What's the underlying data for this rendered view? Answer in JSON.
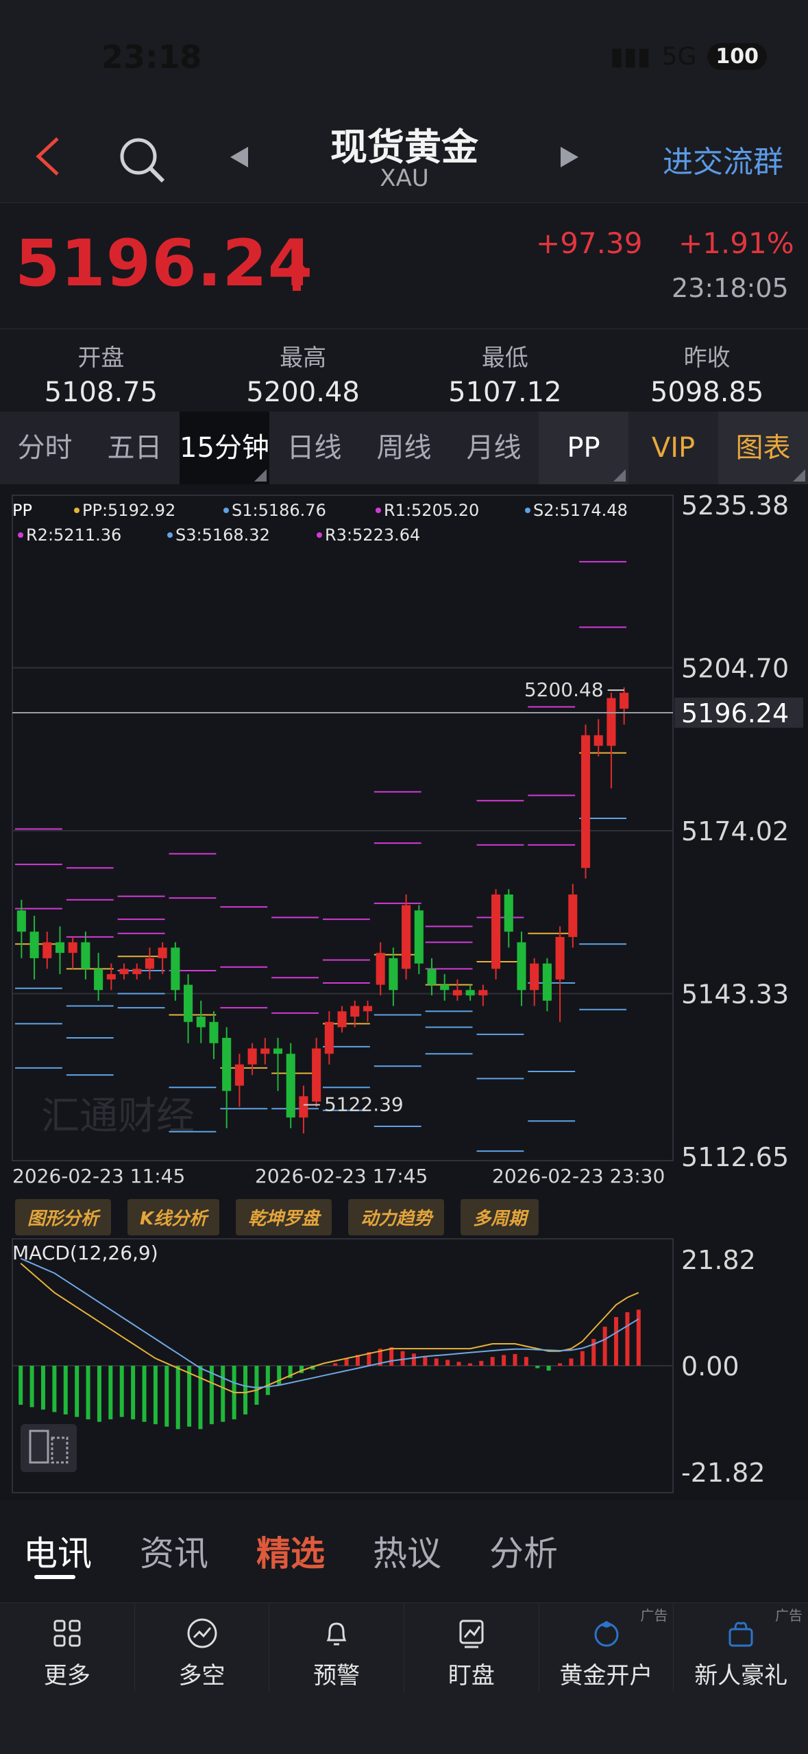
{
  "status": {
    "time": "23:18",
    "network": "5G",
    "battery": "100"
  },
  "header": {
    "title": "现货黄金",
    "subtitle": "XAU",
    "group_link": "进交流群"
  },
  "quote": {
    "price": "5196.24",
    "change": "+97.39",
    "pct": "+1.91%",
    "time": "23:18:05"
  },
  "stats": [
    {
      "label": "开盘",
      "value": "5108.75"
    },
    {
      "label": "最高",
      "value": "5200.48"
    },
    {
      "label": "最低",
      "value": "5107.12"
    },
    {
      "label": "昨收",
      "value": "5098.85"
    }
  ],
  "tabs": [
    "分时",
    "五日",
    "15分钟",
    "日线",
    "周线",
    "月线",
    "PP",
    "VIP",
    "图表"
  ],
  "pivot": {
    "header": "PP",
    "pp": "PP:5192.92",
    "s1": "S1:5186.76",
    "r1": "R1:5205.20",
    "s2": "S2:5174.48",
    "r2": "R2:5211.36",
    "s3": "S3:5168.32",
    "r3": "R3:5223.64"
  },
  "chart_data": {
    "type": "candlestick",
    "y_ticks": [
      "5235.38",
      "5204.70",
      "5174.02",
      "5143.33",
      "5112.65"
    ],
    "y_range": [
      5112.65,
      5235.38
    ],
    "last_price_label": "5196.24",
    "high_label": "5200.48",
    "low_label": "5122.39",
    "x_labels": [
      "2026-02-23 11:45",
      "2026-02-23 17:45",
      "2026-02-23 23:30"
    ],
    "candles": [
      {
        "o": 5159,
        "c": 5155,
        "h": 5161,
        "l": 5150
      },
      {
        "o": 5155,
        "c": 5150,
        "h": 5158,
        "l": 5146
      },
      {
        "o": 5150,
        "c": 5153,
        "h": 5155,
        "l": 5148
      },
      {
        "o": 5153,
        "c": 5151,
        "h": 5156,
        "l": 5147
      },
      {
        "o": 5151,
        "c": 5153,
        "h": 5154,
        "l": 5148
      },
      {
        "o": 5153,
        "c": 5148,
        "h": 5155,
        "l": 5146
      },
      {
        "o": 5148,
        "c": 5144,
        "h": 5151,
        "l": 5142
      },
      {
        "o": 5146,
        "c": 5147,
        "h": 5149,
        "l": 5144
      },
      {
        "o": 5147,
        "c": 5148,
        "h": 5149,
        "l": 5146
      },
      {
        "o": 5147,
        "c": 5148,
        "h": 5149,
        "l": 5146
      },
      {
        "o": 5148,
        "c": 5150,
        "h": 5152,
        "l": 5146
      },
      {
        "o": 5150,
        "c": 5152,
        "h": 5153,
        "l": 5147
      },
      {
        "o": 5152,
        "c": 5144,
        "h": 5153,
        "l": 5142
      },
      {
        "o": 5145,
        "c": 5138,
        "h": 5147,
        "l": 5134
      },
      {
        "o": 5139,
        "c": 5137,
        "h": 5142,
        "l": 5134
      },
      {
        "o": 5138,
        "c": 5134,
        "h": 5140,
        "l": 5131
      },
      {
        "o": 5135,
        "c": 5125,
        "h": 5137,
        "l": 5118
      },
      {
        "o": 5126,
        "c": 5130,
        "h": 5132,
        "l": 5122
      },
      {
        "o": 5130,
        "c": 5133,
        "h": 5134,
        "l": 5128
      },
      {
        "o": 5132,
        "c": 5133,
        "h": 5135,
        "l": 5130
      },
      {
        "o": 5133,
        "c": 5132,
        "h": 5135,
        "l": 5125
      },
      {
        "o": 5132,
        "c": 5120,
        "h": 5134,
        "l": 5118
      },
      {
        "o": 5120,
        "c": 5124,
        "h": 5126,
        "l": 5117
      },
      {
        "o": 5123,
        "c": 5133,
        "h": 5135,
        "l": 5122
      },
      {
        "o": 5132,
        "c": 5138,
        "h": 5140,
        "l": 5130
      },
      {
        "o": 5137,
        "c": 5140,
        "h": 5141,
        "l": 5136
      },
      {
        "o": 5139,
        "c": 5141,
        "h": 5142,
        "l": 5137
      },
      {
        "o": 5140,
        "c": 5141,
        "h": 5142,
        "l": 5138
      },
      {
        "o": 5145,
        "c": 5151,
        "h": 5153,
        "l": 5143
      },
      {
        "o": 5150,
        "c": 5144,
        "h": 5152,
        "l": 5141
      },
      {
        "o": 5148,
        "c": 5160,
        "h": 5162,
        "l": 5146
      },
      {
        "o": 5159,
        "c": 5149,
        "h": 5160,
        "l": 5147
      },
      {
        "o": 5148,
        "c": 5145,
        "h": 5150,
        "l": 5143
      },
      {
        "o": 5145,
        "c": 5144,
        "h": 5147,
        "l": 5142
      },
      {
        "o": 5143,
        "c": 5144,
        "h": 5146,
        "l": 5142
      },
      {
        "o": 5144,
        "c": 5143,
        "h": 5145,
        "l": 5142
      },
      {
        "o": 5143,
        "c": 5144,
        "h": 5145,
        "l": 5141
      },
      {
        "o": 5148,
        "c": 5162,
        "h": 5163,
        "l": 5146
      },
      {
        "o": 5162,
        "c": 5155,
        "h": 5163,
        "l": 5152
      },
      {
        "o": 5153,
        "c": 5144,
        "h": 5155,
        "l": 5141
      },
      {
        "o": 5144,
        "c": 5149,
        "h": 5150,
        "l": 5141
      },
      {
        "o": 5149,
        "c": 5142,
        "h": 5150,
        "l": 5140
      },
      {
        "o": 5146,
        "c": 5154,
        "h": 5156,
        "l": 5138
      },
      {
        "o": 5154,
        "c": 5162,
        "h": 5164,
        "l": 5152
      },
      {
        "o": 5167,
        "c": 5192,
        "h": 5194,
        "l": 5165
      },
      {
        "o": 5190,
        "c": 5192,
        "h": 5195,
        "l": 5188
      },
      {
        "o": 5190,
        "c": 5199,
        "h": 5200,
        "l": 5182
      },
      {
        "o": 5197,
        "c": 5200,
        "h": 5201,
        "l": 5194
      }
    ],
    "macd": {
      "label": "MACD(12,26,9)",
      "y_ticks": [
        "21.82",
        "0.00",
        "-21.82"
      ],
      "y_range": [
        -21.82,
        21.82
      ],
      "hist": [
        -8,
        -8.5,
        -9,
        -9.5,
        -10,
        -10.5,
        -11,
        -11.5,
        -11,
        -10.5,
        -11,
        -11.5,
        -12,
        -12.5,
        -13,
        -12.5,
        -13,
        -12,
        -11.5,
        -11,
        -10,
        -8,
        -6,
        -4,
        -2.5,
        -1.5,
        -0.8,
        0,
        0.5,
        1.5,
        2.2,
        2.8,
        3.5,
        3.8,
        3,
        2.5,
        2,
        1.5,
        1.2,
        0.8,
        0.5,
        1,
        1.8,
        2.2,
        2.4,
        1.8,
        -0.5,
        -1,
        0.5,
        1.5,
        3,
        5.5,
        8,
        10,
        11,
        11.5
      ],
      "dif": [
        21,
        19,
        17,
        15,
        13.5,
        12,
        10.5,
        9,
        7.5,
        6,
        4.5,
        3,
        1.5,
        0.5,
        -0.5,
        -1.5,
        -2.5,
        -3.5,
        -4.5,
        -5.5,
        -5.5,
        -5,
        -4,
        -3,
        -2,
        -1,
        -0.2,
        0.5,
        1,
        1.5,
        2,
        2.5,
        3,
        3.5,
        3.5,
        3.5,
        3.5,
        3.5,
        3.5,
        3.5,
        3.5,
        4,
        4.5,
        4.5,
        4.5,
        4,
        3.5,
        3,
        3,
        3.5,
        5,
        7.5,
        10,
        12.5,
        14,
        15
      ],
      "dea": [
        22,
        21,
        20,
        19,
        17.5,
        16,
        14.5,
        13,
        11.5,
        10,
        8.5,
        7,
        5.5,
        4,
        2.5,
        1,
        -0.5,
        -1.5,
        -2.5,
        -3.5,
        -4.2,
        -4.5,
        -4.3,
        -4,
        -3.5,
        -3,
        -2.5,
        -2,
        -1.5,
        -1,
        -0.5,
        0,
        0.5,
        1,
        1.3,
        1.6,
        1.9,
        2.1,
        2.3,
        2.5,
        2.7,
        2.9,
        3.1,
        3.3,
        3.4,
        3.4,
        3.3,
        3.2,
        3.1,
        3.2,
        3.6,
        4.4,
        5.4,
        6.8,
        8.2,
        9.6
      ]
    }
  },
  "feature_buttons": [
    "图形分析",
    "K线分析",
    "乾坤罗盘",
    "动力趋势",
    "多周期"
  ],
  "watermark": "汇通财经",
  "news_tabs": [
    "电讯",
    "资讯",
    "精选",
    "热议",
    "分析"
  ],
  "bottom_bar": [
    {
      "label": "更多",
      "icon": "grid-icon"
    },
    {
      "label": "多空",
      "icon": "trend-icon"
    },
    {
      "label": "预警",
      "icon": "bell-icon"
    },
    {
      "label": "盯盘",
      "icon": "monitor-icon"
    },
    {
      "label": "黄金开户",
      "icon": "account-icon",
      "ad": "广告"
    },
    {
      "label": "新人豪礼",
      "icon": "gift-icon",
      "ad": "广告"
    }
  ],
  "colors": {
    "up": "#e22b2b",
    "down": "#1fb83a",
    "pp": "#e5b33b",
    "r": "#d33ad8",
    "s": "#5fa3e6"
  }
}
